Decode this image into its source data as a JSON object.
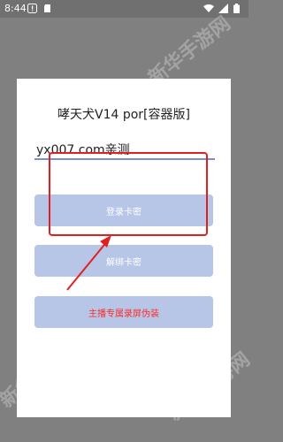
{
  "status_bar": {
    "time": "8:44",
    "left_icons": [
      "alert-icon",
      "sd-card-icon"
    ],
    "right_icons": [
      "wifi-icon",
      "signal-icon",
      "battery-icon"
    ]
  },
  "dialog": {
    "title": "哮天犬V14 por[容器版]",
    "input": {
      "value": "yx007.com亲测"
    },
    "buttons": {
      "login": "登录卡密",
      "unbind": "解绑卡密",
      "screen_disguise": "主播专属录屏伪装"
    }
  },
  "watermark": {
    "text": "新华手游网"
  },
  "colors": {
    "overlay": "#808080",
    "button_bg": "#b7c5e6",
    "annotation": "#e21f1f",
    "danger_text": "#ff2a2a",
    "input_line": "#7a8fd1"
  }
}
